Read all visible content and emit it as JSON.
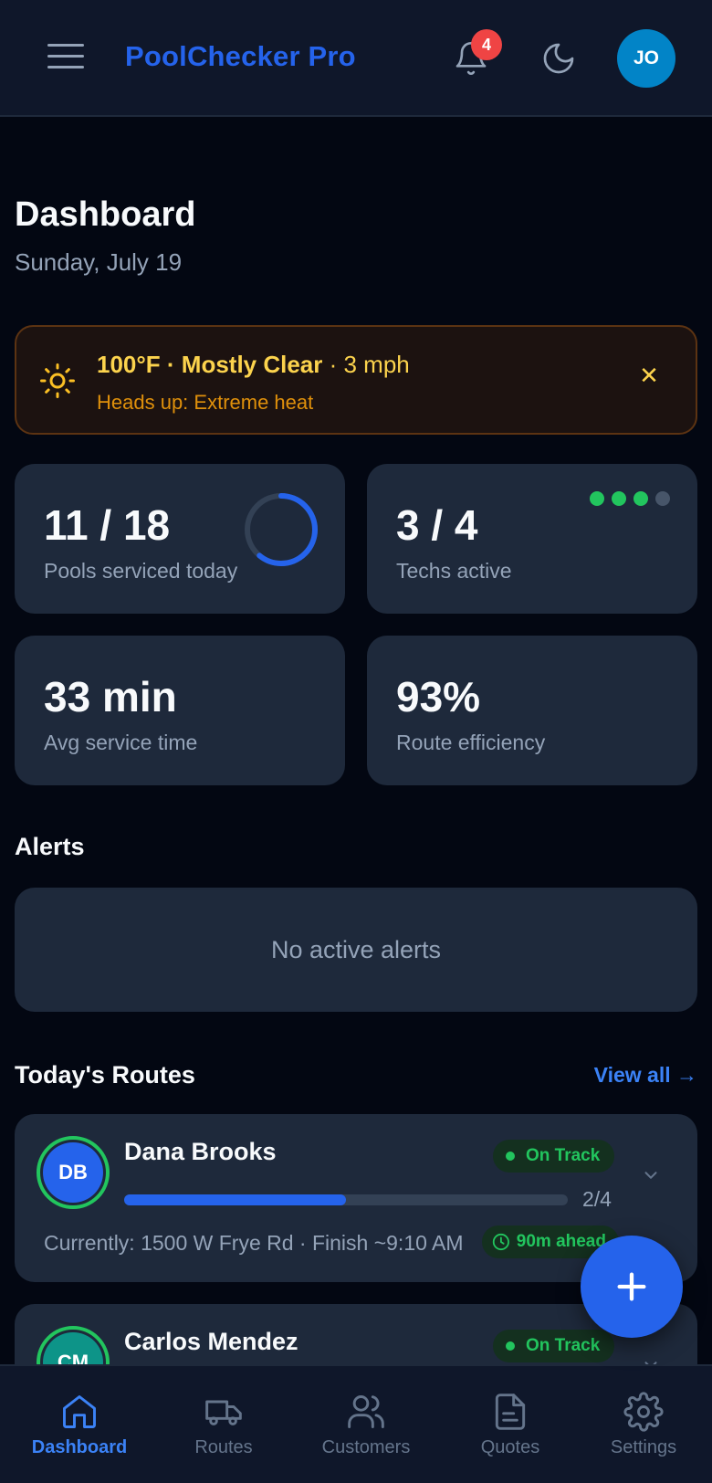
{
  "header": {
    "app_title": "PoolChecker Pro",
    "notification_count": "4",
    "user_initials": "JO"
  },
  "page": {
    "title": "Dashboard",
    "date": "Sunday, July 19"
  },
  "weather": {
    "temperature": "100°F",
    "separator": " · ",
    "condition": "Mostly Clear",
    "wind": " · 3 mph",
    "notice": "Heads up: Extreme heat",
    "close_symbol": "✕"
  },
  "stats": {
    "pools": {
      "value": "11 / 18",
      "label": "Pools serviced today",
      "progress": 0.61
    },
    "techs": {
      "value": "3 / 4",
      "label": "Techs active",
      "dots": [
        "#22c55e",
        "#22c55e",
        "#22c55e",
        "#475569"
      ]
    },
    "avg_time": {
      "value": "33 min",
      "label": "Avg service time"
    },
    "efficiency": {
      "value": "93%",
      "label": "Route efficiency"
    }
  },
  "alerts": {
    "title": "Alerts",
    "empty_text": "No active alerts"
  },
  "routes": {
    "title": "Today's Routes",
    "view_all": "View all →",
    "items": [
      {
        "initials": "DB",
        "name": "Dana Brooks",
        "status": "On Track",
        "progress": 0.5,
        "count": "2/4",
        "meta": "Currently: 1500 W Frye Rd · Finish ~9:10 AM",
        "ahead": "90m ahead",
        "avatar_color": "#2563eb"
      },
      {
        "initials": "CM",
        "name": "Carlos Mendez",
        "status": "On Track",
        "avatar_color": "#0d9488"
      }
    ]
  },
  "nav": {
    "items": [
      "Dashboard",
      "Routes",
      "Customers",
      "Quotes",
      "Settings"
    ],
    "active": "Dashboard"
  },
  "colors": {
    "accent": "#2563eb",
    "success": "#22c55e",
    "warning": "#fcd34d",
    "danger": "#ef4444"
  }
}
